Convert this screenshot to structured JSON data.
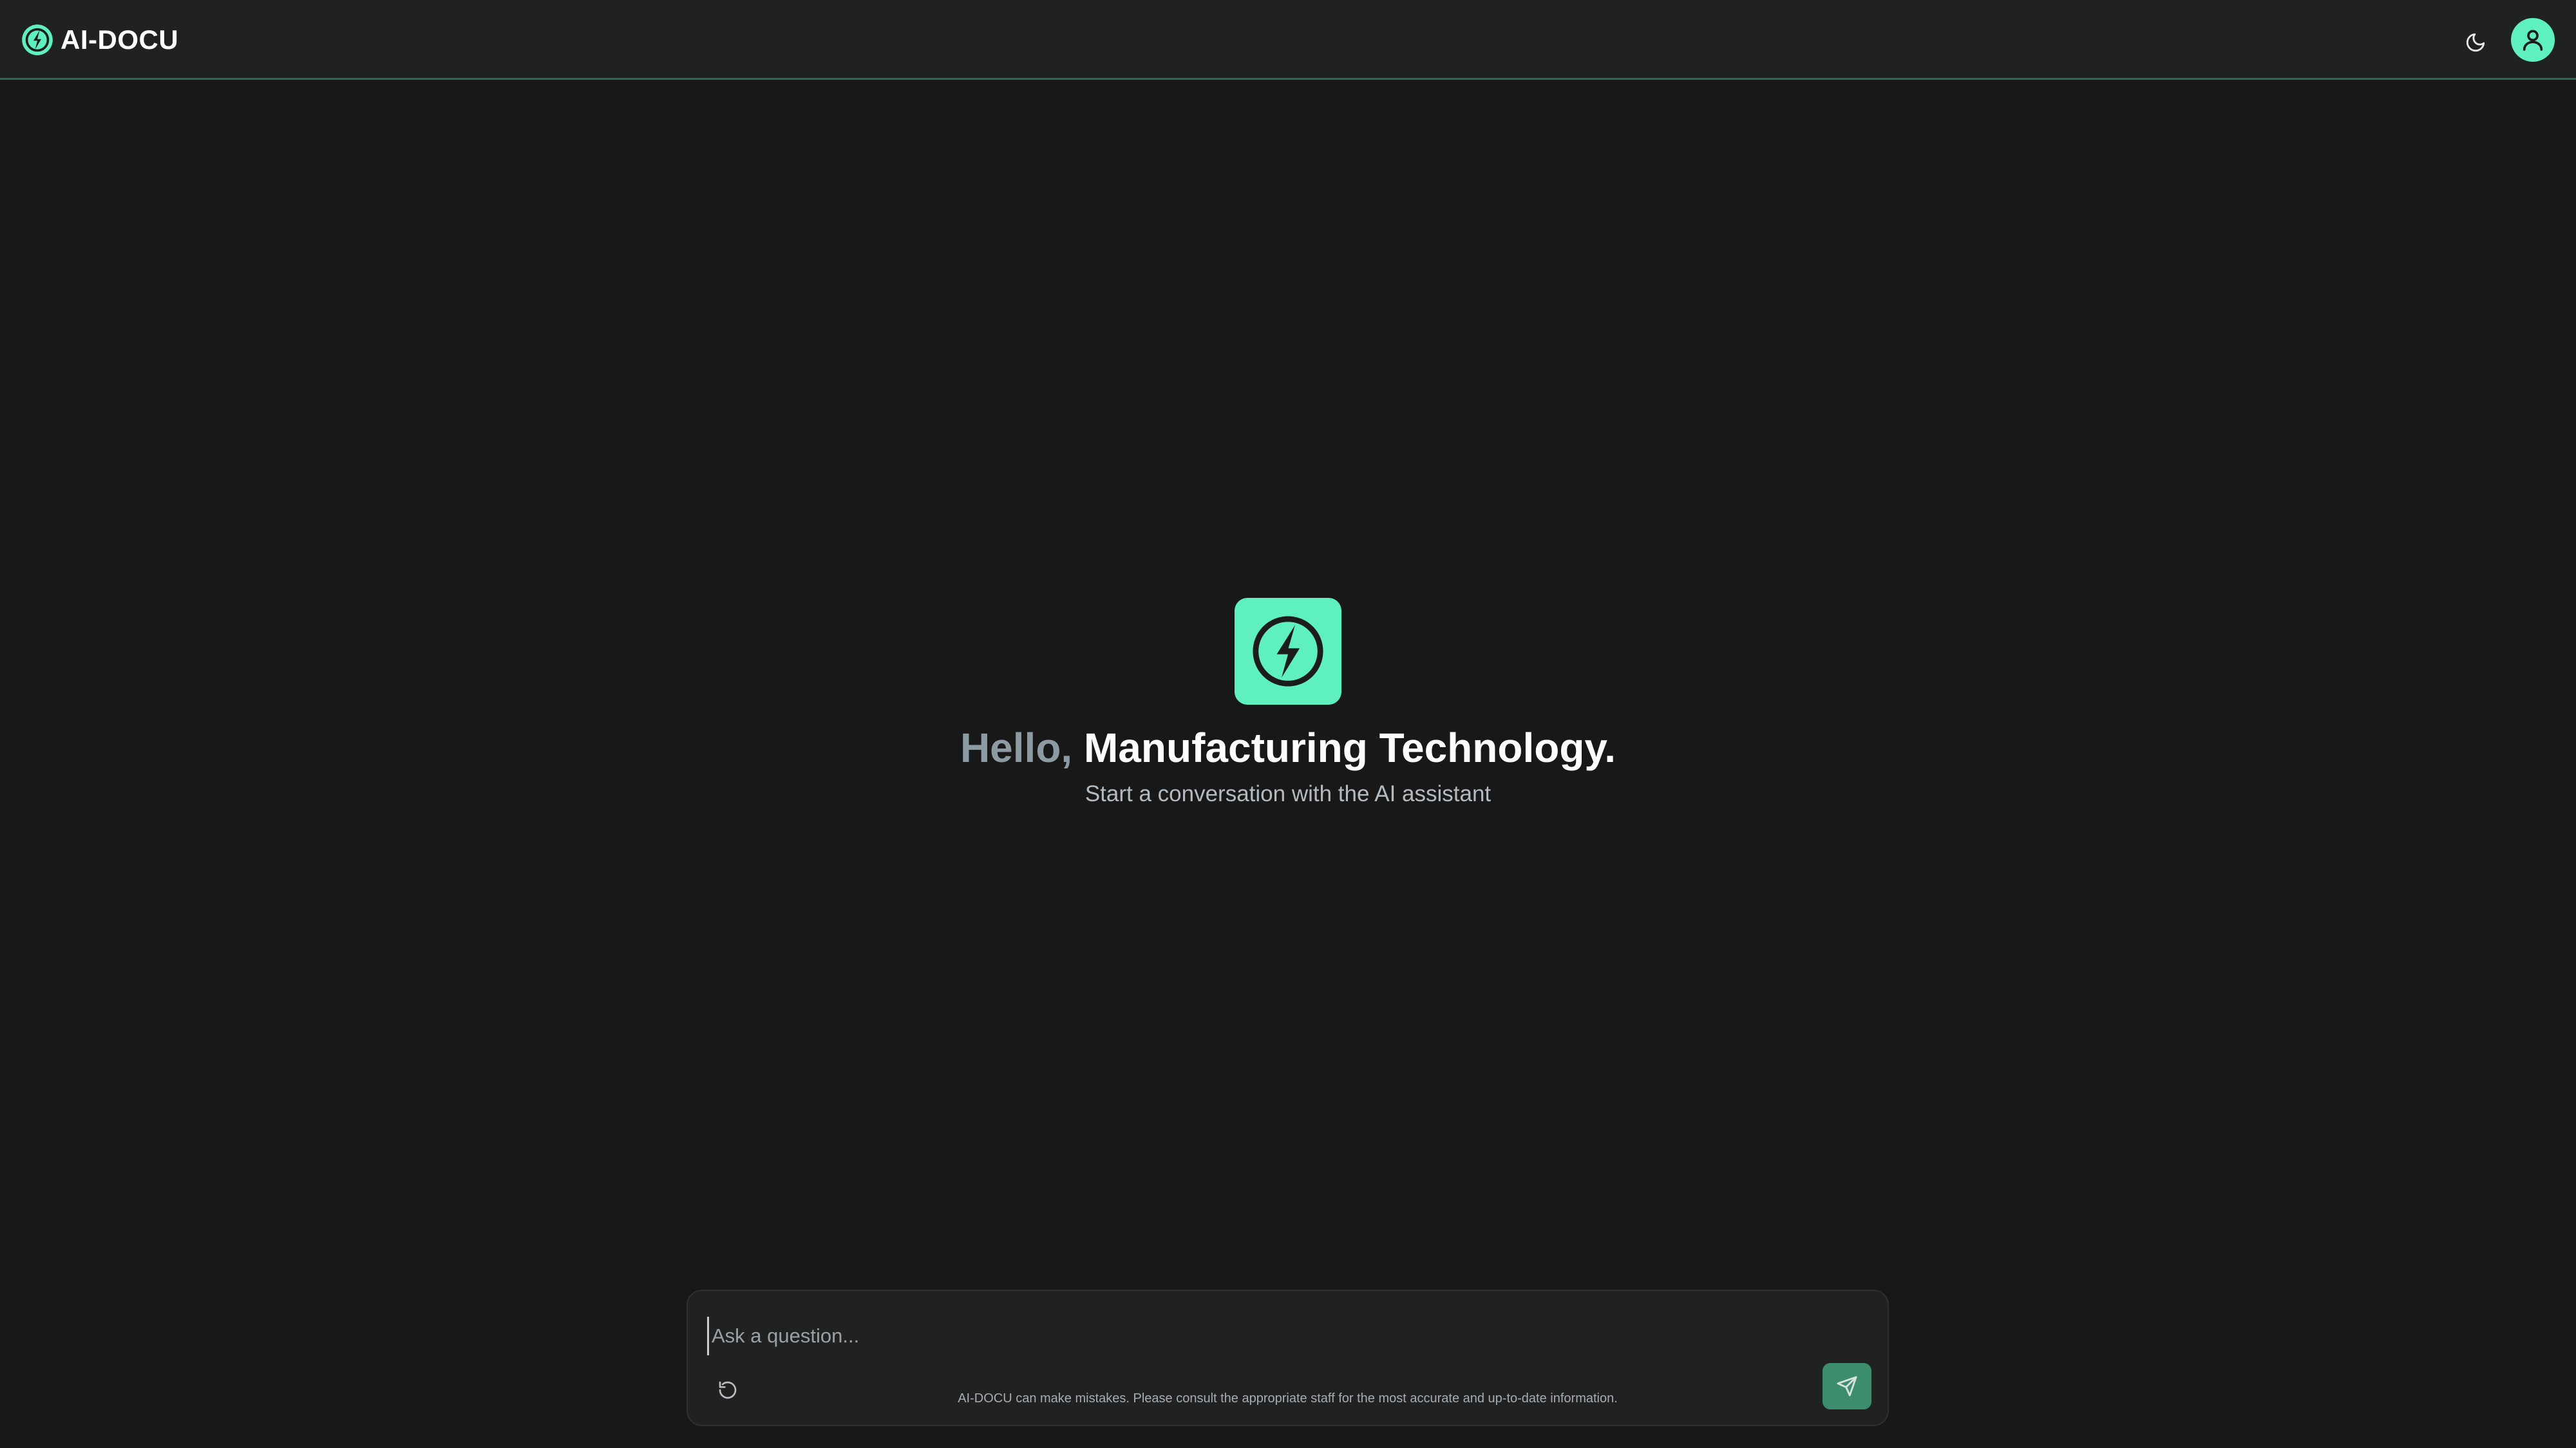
{
  "header": {
    "brand_name": "AI-DOCU",
    "brand_icon": "bolt-circle-icon",
    "theme_toggle_icon": "moon-icon",
    "avatar_icon": "user-icon"
  },
  "hero": {
    "logo_icon": "bolt-circle-icon",
    "greeting": "Hello,",
    "name": "Manufacturing Technology.",
    "subtitle": "Start a conversation with the AI assistant"
  },
  "composer": {
    "placeholder": "Ask a question...",
    "value": "",
    "reset_icon": "rotate-ccw-icon",
    "send_icon": "send-icon",
    "disclaimer": "AI-DOCU can make mistakes. Please consult the appropriate staff for the most accurate and up-to-date information."
  },
  "colors": {
    "background": "#181818",
    "header_background": "#202121",
    "accent": "#5ef0bf",
    "send_button": "#3b8d6d",
    "header_border": "#2c6a58"
  }
}
